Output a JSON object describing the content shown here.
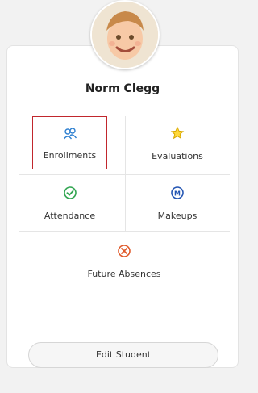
{
  "student": {
    "name": "Norm Clegg"
  },
  "actions": {
    "enrollments": {
      "label": "Enrollments",
      "icon": "users-icon",
      "color": "#2d7fd0"
    },
    "evaluations": {
      "label": "Evaluations",
      "icon": "star-icon",
      "color": "#e2b400"
    },
    "attendance": {
      "label": "Attendance",
      "icon": "check-circle-icon",
      "color": "#2fa44f"
    },
    "makeups": {
      "label": "Makeups",
      "icon": "makeup-icon",
      "icon_text": "M",
      "color": "#2456b3"
    },
    "future_absences": {
      "label": "Future Absences",
      "icon": "x-circle-icon",
      "color": "#e05a2b"
    }
  },
  "footer": {
    "edit_label": "Edit Student"
  },
  "colors": {
    "selection": "#c1272d"
  }
}
